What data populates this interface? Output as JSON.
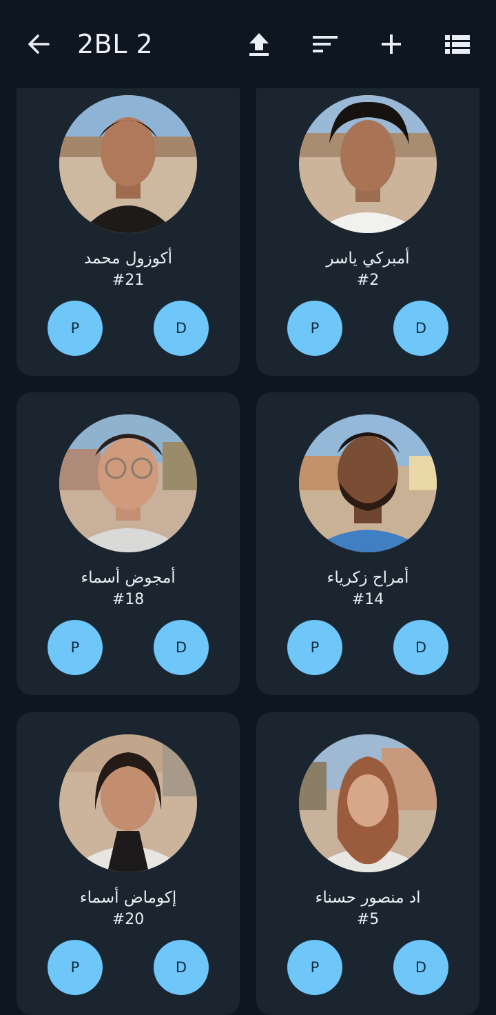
{
  "appbar": {
    "title": "2BL 2",
    "icons": [
      "back-arrow-icon",
      "upload-icon",
      "sort-icon",
      "add-icon",
      "list-view-icon"
    ]
  },
  "students": [
    {
      "name": "أكوزول محمد",
      "number": "#21",
      "p_label": "P",
      "d_label": "D"
    },
    {
      "name": "أمبركي ياسر",
      "number": "#2",
      "p_label": "P",
      "d_label": "D"
    },
    {
      "name": "أمجوض أسماء",
      "number": "#18",
      "p_label": "P",
      "d_label": "D"
    },
    {
      "name": "أمراح زكرياء",
      "number": "#14",
      "p_label": "P",
      "d_label": "D"
    },
    {
      "name": "إكوماض أسماء",
      "number": "#20",
      "p_label": "P",
      "d_label": "D"
    },
    {
      "name": "اد منصور حسناء",
      "number": "#5",
      "p_label": "P",
      "d_label": "D"
    }
  ],
  "colors": {
    "background": "#0e1621",
    "card": "#1a2530",
    "button": "#6ec6f9",
    "button_text": "#102a3a",
    "text": "#e9eef3"
  }
}
